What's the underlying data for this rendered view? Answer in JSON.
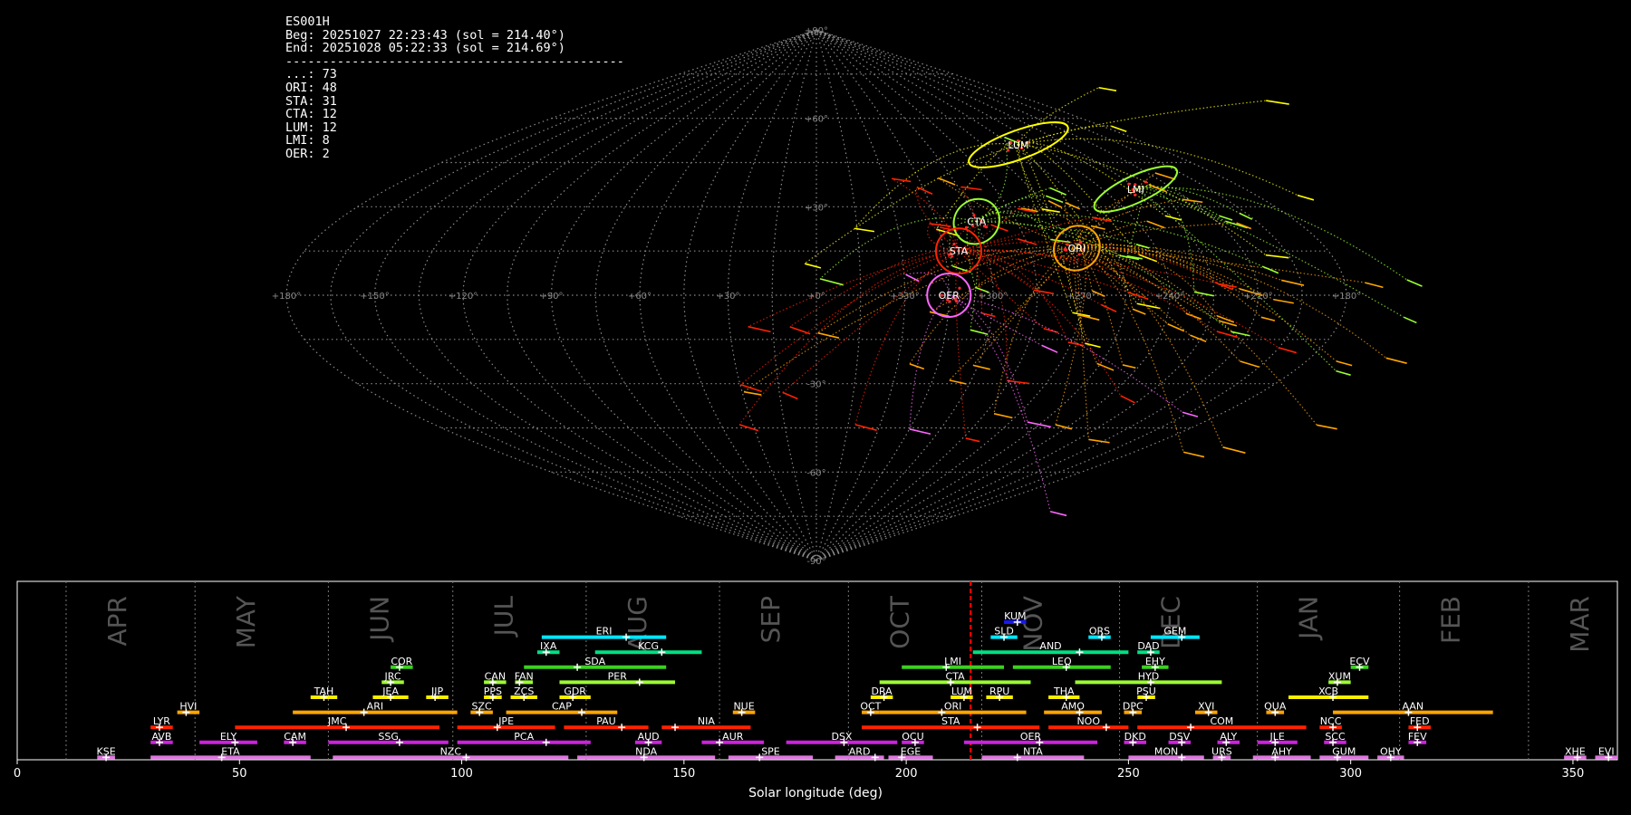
{
  "station": {
    "code": "ES001H",
    "begin": "Beg: 20251027 22:23:43 (sol = 214.40°)",
    "end": "End: 20251028 05:22:33 (sol = 214.69°)",
    "separator": "----------------------------------------------",
    "counts": [
      {
        "label": "...: 73"
      },
      {
        "label": "ORI: 48"
      },
      {
        "label": "STA: 31"
      },
      {
        "label": "CTA: 12"
      },
      {
        "label": "LUM: 12"
      },
      {
        "label": "LMI: 8"
      },
      {
        "label": "OER: 2"
      }
    ]
  },
  "sky_map": {
    "projection": "sinusoidal",
    "lon_labels": [
      "+180°",
      "+150°",
      "+120°",
      "+90°",
      "+60°",
      "+30°",
      "+0°",
      "+330°",
      "+300°",
      "+270°",
      "+240°",
      "+210°",
      "+180°"
    ],
    "lat_labels": [
      "+90°",
      "+60°",
      "+30°",
      "+0°",
      "-30°",
      "-60°",
      "-90°"
    ],
    "radiants": [
      {
        "code": "LUM",
        "lon": 109,
        "lat": 51,
        "rx": 1.0,
        "ry": 0.7,
        "color": "#ffff00"
      },
      {
        "code": "LMI",
        "lon": 134,
        "lat": 36,
        "rx": 1.0,
        "ry": 0.7,
        "color": "#9bff2f"
      },
      {
        "code": "ORI",
        "lon": 92,
        "lat": 16,
        "rx": 0.8,
        "ry": 0.8,
        "color": "#ffa500"
      },
      {
        "code": "CTA",
        "lon": 60,
        "lat": 25,
        "rx": 0.8,
        "ry": 0.8,
        "color": "#9bff2f"
      },
      {
        "code": "STA",
        "lon": 50,
        "lat": 15,
        "rx": 0.8,
        "ry": 0.8,
        "color": "#ff2200"
      },
      {
        "code": "OER",
        "lon": 45,
        "lat": 0,
        "rx": 0.8,
        "ry": 0.8,
        "color": "#ff66ff"
      }
    ]
  },
  "chart_data": {
    "type": "timeline",
    "xlabel": "Solar longitude (deg)",
    "xlim": [
      0,
      360
    ],
    "xticks": [
      0,
      50,
      100,
      150,
      200,
      250,
      300,
      350
    ],
    "current_sol": 214.5,
    "months": [
      {
        "name": "APR",
        "start": 11
      },
      {
        "name": "MAY",
        "start": 40
      },
      {
        "name": "JUN",
        "start": 70
      },
      {
        "name": "JUL",
        "start": 98
      },
      {
        "name": "AUG",
        "start": 128
      },
      {
        "name": "SEP",
        "start": 158
      },
      {
        "name": "OCT",
        "start": 187
      },
      {
        "name": "NOV",
        "start": 217
      },
      {
        "name": "DEC",
        "start": 248
      },
      {
        "name": "JAN",
        "start": 279
      },
      {
        "name": "FEB",
        "start": 311
      },
      {
        "name": "MAR",
        "start": 340
      }
    ],
    "showers": [
      {
        "code": "KUM",
        "start": 222,
        "end": 227,
        "peak": 225,
        "row": 0,
        "color": "#1818ee"
      },
      {
        "code": "ERI",
        "start": 118,
        "end": 146,
        "peak": 137,
        "row": 1,
        "color": "#00e5ff"
      },
      {
        "code": "SLD",
        "start": 219,
        "end": 225,
        "peak": 222,
        "row": 1,
        "color": "#00e5ff"
      },
      {
        "code": "ORS",
        "start": 241,
        "end": 246,
        "peak": 244,
        "row": 1,
        "color": "#00e5ff"
      },
      {
        "code": "GEM",
        "start": 255,
        "end": 266,
        "peak": 262,
        "row": 1,
        "color": "#00e5ff"
      },
      {
        "code": "IXA",
        "start": 117,
        "end": 122,
        "peak": 119,
        "row": 2,
        "color": "#00e083"
      },
      {
        "code": "KCG",
        "start": 130,
        "end": 154,
        "peak": 145,
        "row": 2,
        "color": "#00e083"
      },
      {
        "code": "AND",
        "start": 215,
        "end": 250,
        "peak": 239,
        "row": 2,
        "color": "#00e083"
      },
      {
        "code": "DAD",
        "start": 252,
        "end": 257,
        "peak": 255,
        "row": 2,
        "color": "#00e083"
      },
      {
        "code": "COR",
        "start": 84,
        "end": 89,
        "peak": 86,
        "row": 3,
        "color": "#3bd020"
      },
      {
        "code": "SDA",
        "start": 114,
        "end": 146,
        "peak": 126,
        "row": 3,
        "color": "#3bd020"
      },
      {
        "code": "LMI",
        "start": 199,
        "end": 222,
        "peak": 209,
        "row": 3,
        "color": "#3bd020"
      },
      {
        "code": "LEQ",
        "start": 224,
        "end": 246,
        "peak": 236,
        "row": 3,
        "color": "#3bd020"
      },
      {
        "code": "EHY",
        "start": 253,
        "end": 259,
        "peak": 256,
        "row": 3,
        "color": "#3bd020"
      },
      {
        "code": "ECV",
        "start": 300,
        "end": 304,
        "peak": 302,
        "row": 3,
        "color": "#3bd020"
      },
      {
        "code": "JRC",
        "start": 82,
        "end": 87,
        "peak": 84,
        "row": 4,
        "color": "#9bff2f"
      },
      {
        "code": "CAN",
        "start": 105,
        "end": 110,
        "peak": 107,
        "row": 4,
        "color": "#9bff2f"
      },
      {
        "code": "FAN",
        "start": 112,
        "end": 116,
        "peak": 113,
        "row": 4,
        "color": "#9bff2f"
      },
      {
        "code": "PER",
        "start": 122,
        "end": 148,
        "peak": 140,
        "row": 4,
        "color": "#9bff2f"
      },
      {
        "code": "CTA",
        "start": 194,
        "end": 228,
        "peak": 210,
        "row": 4,
        "color": "#9bff2f"
      },
      {
        "code": "HYD",
        "start": 238,
        "end": 271,
        "peak": 255,
        "row": 4,
        "color": "#9bff2f"
      },
      {
        "code": "XUM",
        "start": 295,
        "end": 300,
        "peak": 297,
        "row": 4,
        "color": "#9bff2f"
      },
      {
        "code": "TAH",
        "start": 66,
        "end": 72,
        "peak": 69,
        "row": 5,
        "color": "#ffee00"
      },
      {
        "code": "JEA",
        "start": 80,
        "end": 88,
        "peak": 84,
        "row": 5,
        "color": "#ffee00"
      },
      {
        "code": "JIP",
        "start": 92,
        "end": 97,
        "peak": 94,
        "row": 5,
        "color": "#ffee00"
      },
      {
        "code": "PPS",
        "start": 105,
        "end": 109,
        "peak": 107,
        "row": 5,
        "color": "#ffee00"
      },
      {
        "code": "ZCS",
        "start": 111,
        "end": 117,
        "peak": 114,
        "row": 5,
        "color": "#ffee00"
      },
      {
        "code": "GDR",
        "start": 122,
        "end": 129,
        "peak": 125,
        "row": 5,
        "color": "#ffee00"
      },
      {
        "code": "DRA",
        "start": 192,
        "end": 197,
        "peak": 195,
        "row": 5,
        "color": "#ffee00"
      },
      {
        "code": "LUM",
        "start": 210,
        "end": 215,
        "peak": 213,
        "row": 5,
        "color": "#ffee00"
      },
      {
        "code": "RPU",
        "start": 218,
        "end": 224,
        "peak": 221,
        "row": 5,
        "color": "#ffee00"
      },
      {
        "code": "THA",
        "start": 232,
        "end": 239,
        "peak": 236,
        "row": 5,
        "color": "#ffee00"
      },
      {
        "code": "PSU",
        "start": 252,
        "end": 256,
        "peak": 254,
        "row": 5,
        "color": "#ffee00"
      },
      {
        "code": "XCB",
        "start": 286,
        "end": 304,
        "peak": 296,
        "row": 5,
        "color": "#ffee00"
      },
      {
        "code": "HVI",
        "start": 36,
        "end": 41,
        "peak": 38,
        "row": 6,
        "color": "#ffa500"
      },
      {
        "code": "ARI",
        "start": 62,
        "end": 99,
        "peak": 78,
        "row": 6,
        "color": "#ffa500"
      },
      {
        "code": "SZC",
        "start": 102,
        "end": 107,
        "peak": 104,
        "row": 6,
        "color": "#ffa500"
      },
      {
        "code": "CAP",
        "start": 110,
        "end": 135,
        "peak": 127,
        "row": 6,
        "color": "#ffa500"
      },
      {
        "code": "NUE",
        "start": 161,
        "end": 166,
        "peak": 163,
        "row": 6,
        "color": "#ffa500"
      },
      {
        "code": "OCT",
        "start": 190,
        "end": 194,
        "peak": 192,
        "row": 6,
        "color": "#ffa500"
      },
      {
        "code": "ORI",
        "start": 194,
        "end": 227,
        "peak": 208,
        "row": 6,
        "color": "#ffa500"
      },
      {
        "code": "AMO",
        "start": 231,
        "end": 244,
        "peak": 239,
        "row": 6,
        "color": "#ffa500"
      },
      {
        "code": "DPC",
        "start": 249,
        "end": 253,
        "peak": 251,
        "row": 6,
        "color": "#ffa500"
      },
      {
        "code": "XVI",
        "start": 265,
        "end": 270,
        "peak": 268,
        "row": 6,
        "color": "#ffa500"
      },
      {
        "code": "QUA",
        "start": 281,
        "end": 285,
        "peak": 283,
        "row": 6,
        "color": "#ffa500"
      },
      {
        "code": "AAN",
        "start": 296,
        "end": 332,
        "peak": 313,
        "row": 6,
        "color": "#ffa500"
      },
      {
        "code": "LYR",
        "start": 30,
        "end": 35,
        "peak": 32,
        "row": 7,
        "color": "#ff2200"
      },
      {
        "code": "JMC",
        "start": 49,
        "end": 95,
        "peak": 74,
        "row": 7,
        "color": "#ff2200"
      },
      {
        "code": "JPE",
        "start": 99,
        "end": 121,
        "peak": 108,
        "row": 7,
        "color": "#ff2200"
      },
      {
        "code": "PAU",
        "start": 123,
        "end": 142,
        "peak": 136,
        "row": 7,
        "color": "#ff2200"
      },
      {
        "code": "NIA",
        "start": 145,
        "end": 165,
        "peak": 148,
        "row": 7,
        "color": "#ff2200"
      },
      {
        "code": "STA",
        "start": 190,
        "end": 230,
        "peak": 216,
        "row": 7,
        "color": "#ff2200"
      },
      {
        "code": "NOO",
        "start": 232,
        "end": 250,
        "peak": 245,
        "row": 7,
        "color": "#ff2200"
      },
      {
        "code": "COM",
        "start": 252,
        "end": 290,
        "peak": 264,
        "row": 7,
        "color": "#ff2200"
      },
      {
        "code": "NCC",
        "start": 293,
        "end": 298,
        "peak": 296,
        "row": 7,
        "color": "#ff2200"
      },
      {
        "code": "FED",
        "start": 313,
        "end": 318,
        "peak": 315,
        "row": 7,
        "color": "#ff2200"
      },
      {
        "code": "AVB",
        "start": 30,
        "end": 35,
        "peak": 32,
        "row": 8,
        "color": "#cc22dd"
      },
      {
        "code": "ELY",
        "start": 41,
        "end": 54,
        "peak": 49,
        "row": 8,
        "color": "#cc22dd"
      },
      {
        "code": "CAM",
        "start": 60,
        "end": 65,
        "peak": 62,
        "row": 8,
        "color": "#cc22dd"
      },
      {
        "code": "SSG",
        "start": 70,
        "end": 97,
        "peak": 86,
        "row": 8,
        "color": "#cc22dd"
      },
      {
        "code": "PCA",
        "start": 99,
        "end": 129,
        "peak": 119,
        "row": 8,
        "color": "#cc22dd"
      },
      {
        "code": "AUD",
        "start": 139,
        "end": 145,
        "peak": 142,
        "row": 8,
        "color": "#cc22dd"
      },
      {
        "code": "AUR",
        "start": 154,
        "end": 168,
        "peak": 158,
        "row": 8,
        "color": "#cc22dd"
      },
      {
        "code": "DSX",
        "start": 173,
        "end": 198,
        "peak": 186,
        "row": 8,
        "color": "#cc22dd"
      },
      {
        "code": "OCU",
        "start": 199,
        "end": 204,
        "peak": 202,
        "row": 8,
        "color": "#cc22dd"
      },
      {
        "code": "OER",
        "start": 213,
        "end": 243,
        "peak": 230,
        "row": 8,
        "color": "#cc22dd"
      },
      {
        "code": "DKD",
        "start": 249,
        "end": 254,
        "peak": 251,
        "row": 8,
        "color": "#cc22dd"
      },
      {
        "code": "DSV",
        "start": 259,
        "end": 264,
        "peak": 262,
        "row": 8,
        "color": "#cc22dd"
      },
      {
        "code": "ALY",
        "start": 270,
        "end": 275,
        "peak": 272,
        "row": 8,
        "color": "#cc22dd"
      },
      {
        "code": "JLE",
        "start": 279,
        "end": 288,
        "peak": 283,
        "row": 8,
        "color": "#cc22dd"
      },
      {
        "code": "SCC",
        "start": 294,
        "end": 299,
        "peak": 296,
        "row": 8,
        "color": "#cc22dd"
      },
      {
        "code": "FEV",
        "start": 313,
        "end": 317,
        "peak": 315,
        "row": 8,
        "color": "#cc22dd"
      },
      {
        "code": "KSE",
        "start": 18,
        "end": 22,
        "peak": 20,
        "row": 9,
        "color": "#dd77dd"
      },
      {
        "code": "ETA",
        "start": 30,
        "end": 66,
        "peak": 46,
        "row": 9,
        "color": "#dd77dd"
      },
      {
        "code": "NZC",
        "start": 71,
        "end": 124,
        "peak": 101,
        "row": 9,
        "color": "#dd77dd"
      },
      {
        "code": "NDA",
        "start": 126,
        "end": 157,
        "peak": 141,
        "row": 9,
        "color": "#dd77dd"
      },
      {
        "code": "SPE",
        "start": 160,
        "end": 179,
        "peak": 167,
        "row": 9,
        "color": "#dd77dd"
      },
      {
        "code": "ARD",
        "start": 184,
        "end": 195,
        "peak": 193,
        "row": 9,
        "color": "#dd77dd"
      },
      {
        "code": "EGE",
        "start": 196,
        "end": 206,
        "peak": 199,
        "row": 9,
        "color": "#dd77dd"
      },
      {
        "code": "NTA",
        "start": 217,
        "end": 240,
        "peak": 225,
        "row": 9,
        "color": "#dd77dd"
      },
      {
        "code": "MON",
        "start": 250,
        "end": 267,
        "peak": 262,
        "row": 9,
        "color": "#dd77dd"
      },
      {
        "code": "URS",
        "start": 269,
        "end": 273,
        "peak": 271,
        "row": 9,
        "color": "#dd77dd"
      },
      {
        "code": "AHY",
        "start": 278,
        "end": 291,
        "peak": 283,
        "row": 9,
        "color": "#dd77dd"
      },
      {
        "code": "GUM",
        "start": 293,
        "end": 304,
        "peak": 297,
        "row": 9,
        "color": "#dd77dd"
      },
      {
        "code": "OHY",
        "start": 306,
        "end": 312,
        "peak": 309,
        "row": 9,
        "color": "#dd77dd"
      },
      {
        "code": "XHE",
        "start": 348,
        "end": 353,
        "peak": 351,
        "row": 9,
        "color": "#dd77dd"
      },
      {
        "code": "EVI",
        "start": 355,
        "end": 360,
        "peak": 358,
        "row": 9,
        "color": "#dd77dd"
      }
    ]
  }
}
